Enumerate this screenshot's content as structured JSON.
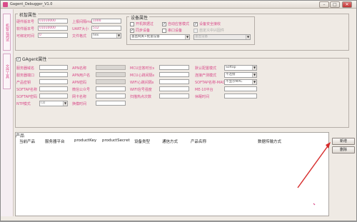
{
  "window": {
    "title": "Gagent_Debugger_V1.0",
    "min_label": "–",
    "max_label": "□",
    "close_label": "✕"
  },
  "sidebar": {
    "tabs": [
      "机智云调试",
      "文件工具"
    ]
  },
  "device_group": {
    "label": "机智属性",
    "hw_label": "硬件版本号",
    "hw_value": "01010000",
    "sw_label": "软件版本号",
    "sw_value": "01010000",
    "mode_label": "可绑定时间",
    "mode_value": "0",
    "report_label": "上报间隔ms",
    "report_value": "1000",
    "uart_label": "UART大小",
    "uart_value": "512",
    "file_label": "文件格式",
    "file_value": "hex"
  },
  "device_attr": {
    "label": "设备属性",
    "checks": [
      {
        "label": "开机数据过",
        "checked": false
      },
      {
        "label": "自动应答模式",
        "checked": true
      },
      {
        "label": "设备安全接收",
        "checked": true
      },
      {
        "label": "同步设备",
        "checked": true
      },
      {
        "label": "串口设备",
        "checked": false
      },
      {
        "label": "自定义中兴固件",
        "checked": false,
        "disabled": true
      }
    ],
    "select1": "垂直网关+批量设备",
    "select2": "垂直设备"
  },
  "gagent_group": {
    "label": "GAgent属性",
    "checked": true,
    "col1": [
      {
        "label": "服务器域名",
        "value": ""
      },
      {
        "label": "服务器端口",
        "value": ""
      },
      {
        "label": "产品密钥",
        "value": ""
      },
      {
        "label": "SOFTAP名称",
        "value": ""
      },
      {
        "label": "SOFTAP密码",
        "value": ""
      },
      {
        "label": "NTP模式",
        "value": "(1)"
      }
    ],
    "col2": [
      {
        "label": "APN名称",
        "value": ""
      },
      {
        "label": "APN用户名",
        "value": ""
      },
      {
        "label": "APN密码",
        "value": ""
      },
      {
        "label": "微信公众号",
        "value": ""
      },
      {
        "label": "网卡名称",
        "value": ""
      },
      {
        "label": "换模时间",
        "value": ""
      }
    ],
    "col3": [
      {
        "label": "MCU应答时长s",
        "value": ""
      },
      {
        "label": "MCU心跳间隔s",
        "value": ""
      },
      {
        "label": "WIFI心跳间隔s",
        "value": ""
      },
      {
        "label": "WIFI信号强度",
        "value": ""
      },
      {
        "label": "扫描热点次数",
        "value": ""
      }
    ],
    "col4": [
      {
        "label": "默认配置模式",
        "value": "Softap"
      },
      {
        "label": "连接产测模式",
        "value": "不连接"
      },
      {
        "label": "SOFTAP名称-MAC",
        "value": "不显示MAC"
      },
      {
        "label": "ME-10平台",
        "value": ""
      },
      {
        "label": "休眠时间",
        "value": ""
      }
    ]
  },
  "products": {
    "title": "产品",
    "columns": [
      "当前产品",
      "服务器平台",
      "productKey",
      "productSecret",
      "设备类型",
      "通信方式",
      "产品名称",
      "数据传输方式"
    ],
    "new_button": "新增",
    "delete_button": "删除"
  }
}
